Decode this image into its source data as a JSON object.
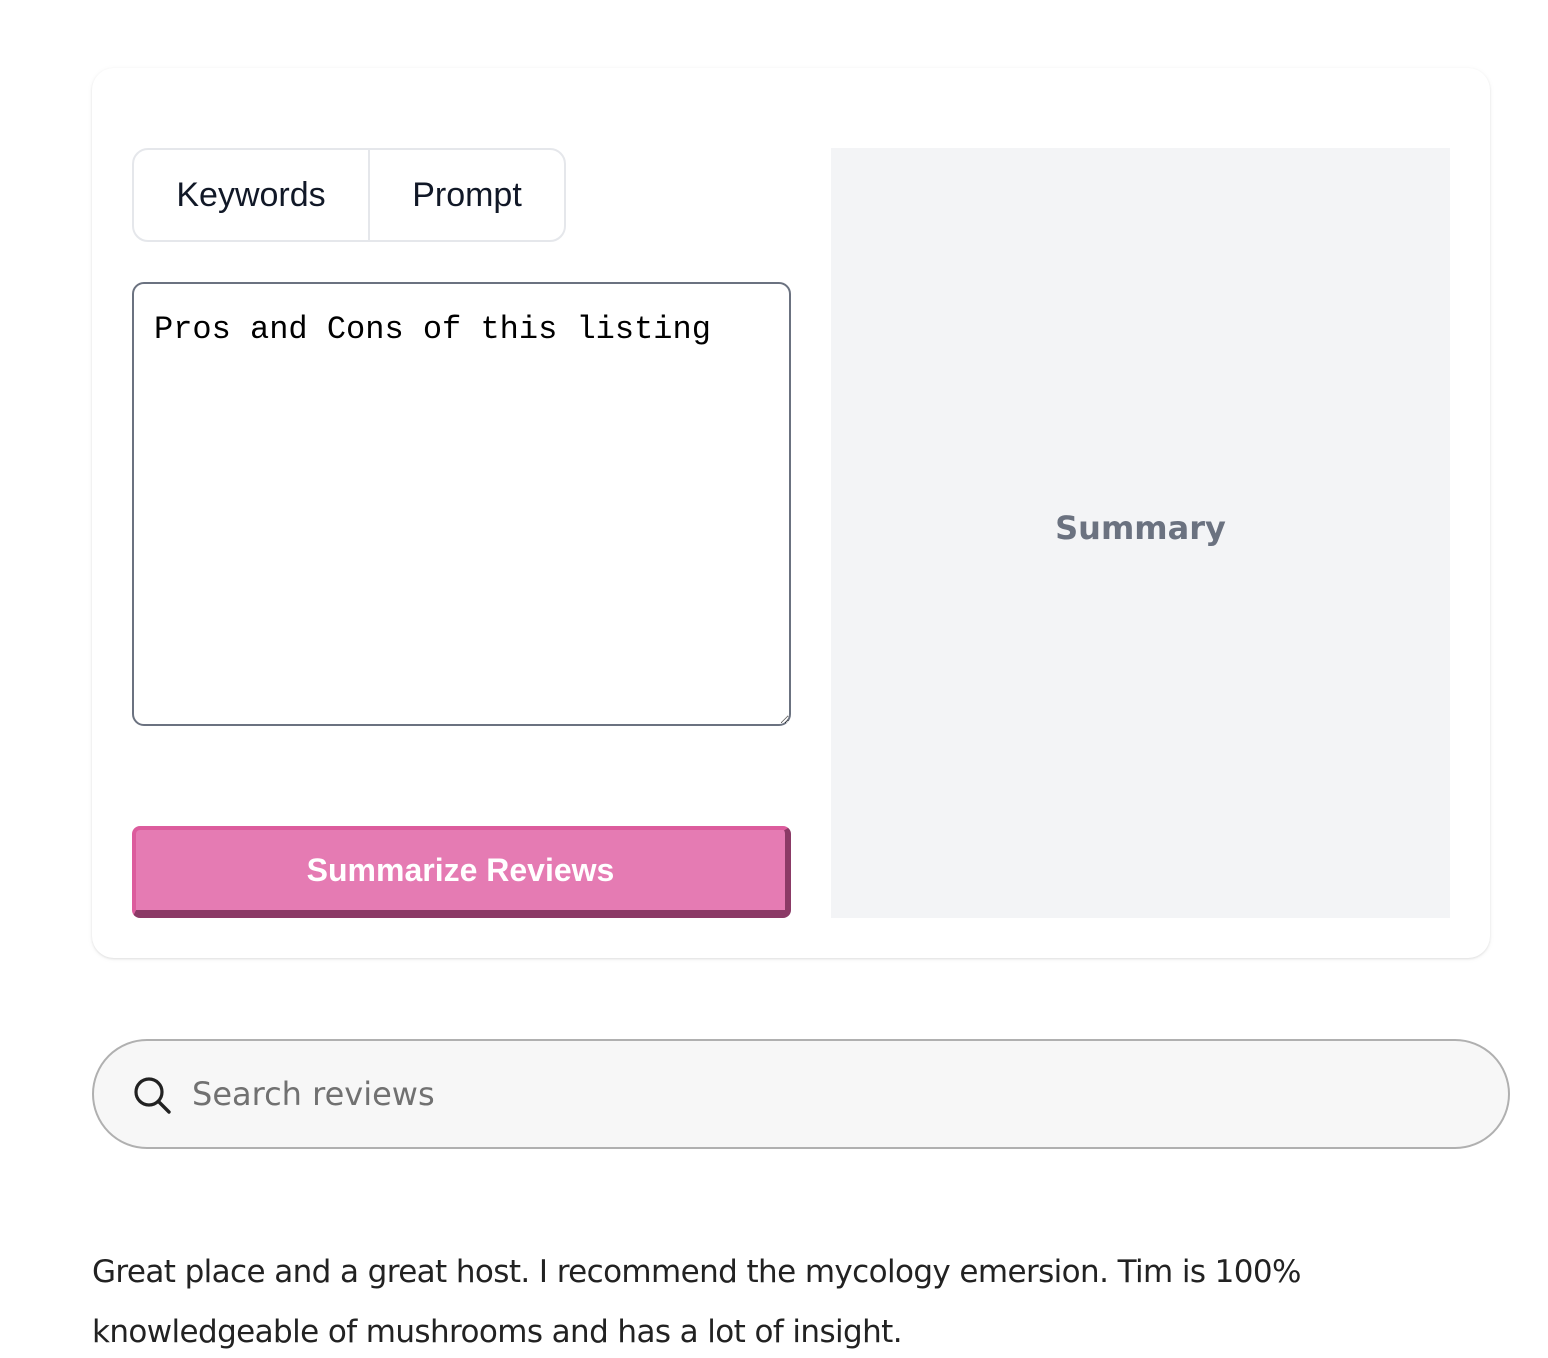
{
  "tabs": [
    {
      "label": "Keywords"
    },
    {
      "label": "Prompt"
    }
  ],
  "prompt": {
    "value": "Pros and Cons of this listing"
  },
  "summarize_button": {
    "label": "Summarize Reviews"
  },
  "summary": {
    "label": "Summary"
  },
  "search": {
    "placeholder": "Search reviews",
    "icon": "search-icon"
  },
  "reviews": [
    {
      "text": "Great place and a great host. I recommend the mycology emersion. Tim is 100% knowledgeable of mushrooms and has a lot of insight."
    }
  ],
  "colors": {
    "accent_button": "#e57bb3",
    "accent_button_shadow": "#8b3a66",
    "summary_bg": "#f3f4f6",
    "summary_text": "#6b7280"
  }
}
